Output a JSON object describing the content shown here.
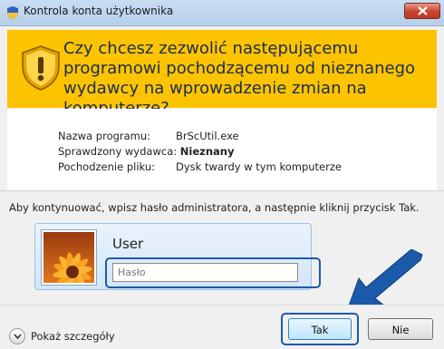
{
  "window": {
    "title": "Kontrola konta użytkownika",
    "accent_color": "#1a5aa8",
    "header_color": "#fcc400"
  },
  "header": {
    "icon": "warning-shield-icon",
    "message": "Czy chcesz zezwolić następującemu programowi pochodzącemu od nieznanego wydawcy na wprowadzenie zmian na komputerze?"
  },
  "details": {
    "program_name_label": "Nazwa programu:",
    "program_name_value": "BrScUtil.exe",
    "publisher_label": "Sprawdzony wydawca:",
    "publisher_value": "Nieznany",
    "origin_label": "Pochodzenie pliku:",
    "origin_value": "Dysk twardy w tym komputerze"
  },
  "instruction": "Aby kontynuować, wpisz hasło administratora, a następnie kliknij przycisk Tak.",
  "credentials": {
    "username": "User",
    "password_placeholder": "Hasło",
    "avatar_icon": "flower-avatar-icon"
  },
  "footer": {
    "show_details_label": "Pokaż szczegóły",
    "yes_label": "Tak",
    "no_label": "Nie"
  }
}
